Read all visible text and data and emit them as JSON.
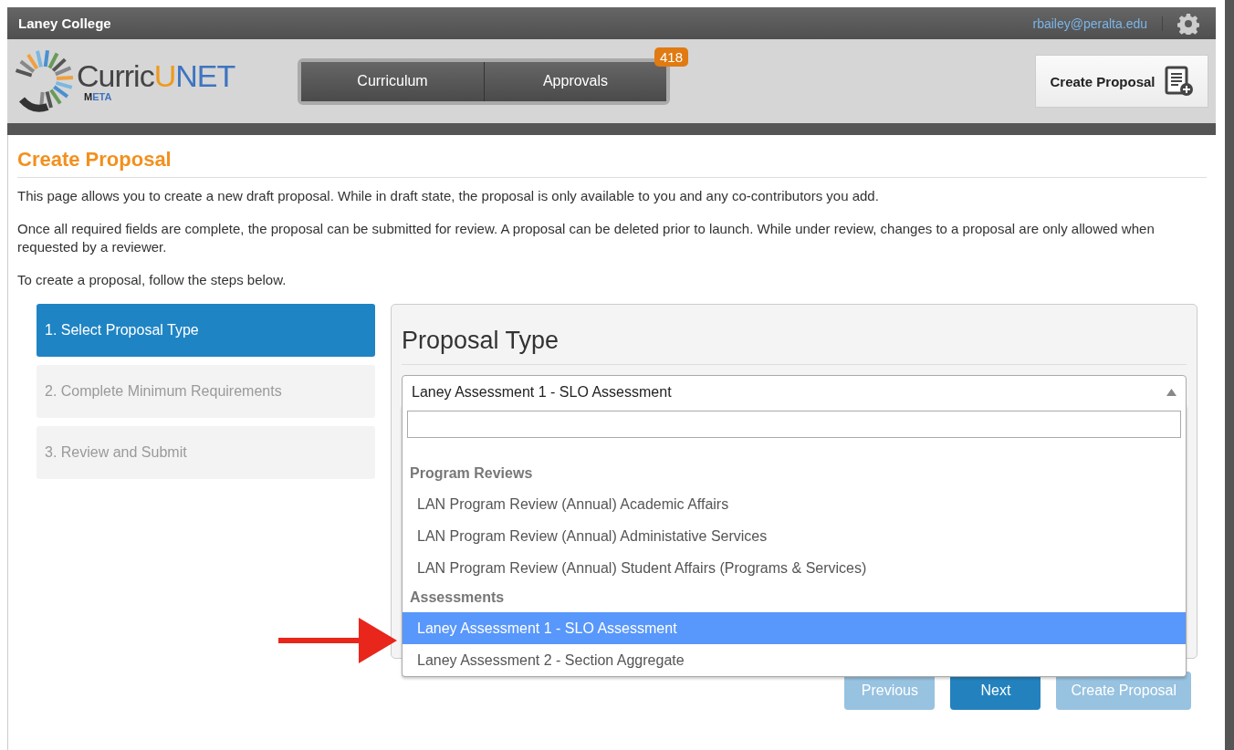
{
  "top_bar": {
    "college": "Laney College",
    "user_email": "rbailey@peralta.edu"
  },
  "logo": {
    "brand_dark": "Curric",
    "brand_orange": "U",
    "brand_blue": "NET",
    "sub_dark": "M",
    "sub_blue": "ETA"
  },
  "nav_tabs": [
    {
      "label": "Curriculum"
    },
    {
      "label": "Approvals",
      "badge": "418"
    }
  ],
  "create_button": "Create Proposal",
  "page": {
    "title": "Create Proposal",
    "paragraphs": [
      "This page allows you to create a new draft proposal. While in draft state, the proposal is only available to you and any co-contributors you add.",
      "Once all required fields are complete, the proposal can be submitted for review. A proposal can be deleted prior to launch. While under review, changes to a proposal are only allowed when requested by a reviewer.",
      "To create a proposal, follow the steps below."
    ]
  },
  "steps": [
    {
      "label": "1. Select Proposal Type",
      "selected": true
    },
    {
      "label": "2. Complete Minimum Requirements",
      "selected": false
    },
    {
      "label": "3. Review and Submit",
      "selected": false
    }
  ],
  "panel": {
    "title": "Proposal Type",
    "select_value": "Laney Assessment 1 - SLO Assessment",
    "expanded": true,
    "groups": [
      {
        "label": "Program Reviews",
        "options": [
          {
            "label": "LAN Program Review (Annual) Academic Affairs",
            "selected": false
          },
          {
            "label": "LAN Program Review (Annual) Administative Services",
            "selected": false
          },
          {
            "label": "LAN Program Review (Annual) Student Affairs (Programs & Services)",
            "selected": false
          }
        ]
      },
      {
        "label": "Assessments",
        "options": [
          {
            "label": "Laney Assessment 1 - SLO Assessment",
            "selected": true
          },
          {
            "label": "Laney Assessment 2 - Section Aggregate",
            "selected": false
          }
        ]
      }
    ]
  },
  "buttons": [
    {
      "label": "Previous",
      "disabled": true
    },
    {
      "label": "Next",
      "disabled": false
    },
    {
      "label": "Create Proposal",
      "disabled": true
    }
  ]
}
